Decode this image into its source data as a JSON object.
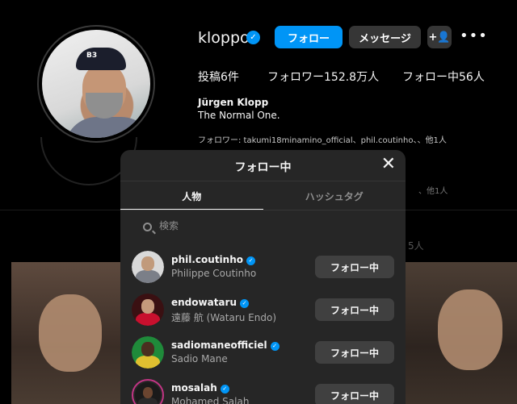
{
  "profile": {
    "username": "kloppo",
    "verified_mark": "✓",
    "buttons": {
      "follow": "フォロー",
      "message": "メッセージ",
      "add_user": "+👤",
      "more": "•••"
    },
    "stats": {
      "posts": "投稿6件",
      "followers": "フォロワー152.8万人",
      "following": "フォロー中56人"
    },
    "full_name": "Jürgen Klopp",
    "bio": "The Normal One.",
    "followed_by": "フォロワー: takumi18minamino_official、phil.coutinho、、他1人",
    "avatar_cap_text": "B3",
    "hidden_text_1": "、他1人",
    "hidden_text_2": "5人"
  },
  "modal": {
    "title": "フォロー中",
    "close_icon": "close-icon",
    "tabs": [
      {
        "label": "人物",
        "active": true
      },
      {
        "label": "ハッシュタグ",
        "active": false
      }
    ],
    "search": {
      "placeholder": "検索"
    },
    "list": [
      {
        "username": "phil.coutinho",
        "full_name": "Philippe Coutinho",
        "button": "フォロー中",
        "verified": true,
        "story": false,
        "bg": "#d9d9d9",
        "head": "#c19a7b",
        "body": "#7b7f88"
      },
      {
        "username": "endowataru",
        "full_name": "遠藤 航 (Wataru Endo)",
        "button": "フォロー中",
        "verified": true,
        "story": false,
        "bg": "#3a1012",
        "head": "#c59a7c",
        "body": "#c8102e"
      },
      {
        "username": "sadiomaneofficiel",
        "full_name": "Sadio Mane",
        "button": "フォロー中",
        "verified": true,
        "story": false,
        "bg": "#1f8a3a",
        "head": "#4a2e1f",
        "body": "#e0c030"
      },
      {
        "username": "mosalah",
        "full_name": "Mohamed Salah",
        "button": "フォロー中",
        "verified": true,
        "story": true,
        "bg": "#1a1a1a",
        "head": "#6b4530",
        "body": "#2a2a2a"
      }
    ]
  },
  "colors": {
    "accent": "#0095f6",
    "modal_bg": "#262626",
    "button_dark": "#404040"
  }
}
